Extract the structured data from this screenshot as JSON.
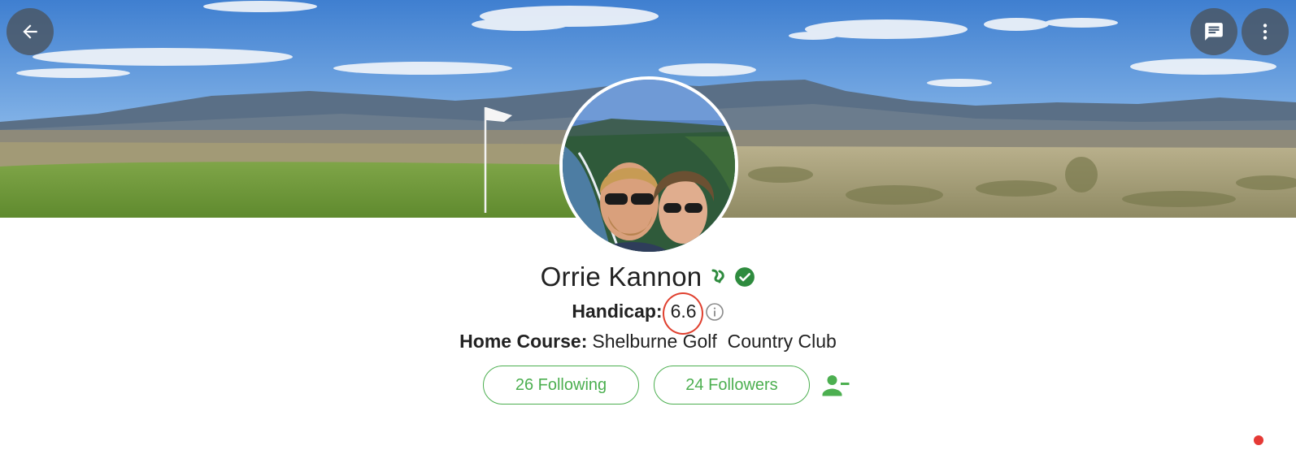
{
  "profile": {
    "name": "Orrie Kannon",
    "handicap_label": "Handicap:",
    "handicap_value": "6.6",
    "home_course_label": "Home Course:",
    "home_course_value": "Shelburne Golf  Country Club"
  },
  "stats": {
    "following_label": "26 Following",
    "followers_label": "24 Followers"
  },
  "icons": {
    "back": "arrow-left-icon",
    "chat": "chat-icon",
    "more": "more-vertical-icon",
    "badge_golf": "golf-badge-icon",
    "badge_verified": "verified-icon",
    "info": "info-icon",
    "unfollow": "person-remove-icon"
  },
  "colors": {
    "accent_green": "#4caf50",
    "verified_green": "#2e8b3e",
    "highlight_red": "#e0402f",
    "button_overlay": "#4a5561"
  }
}
